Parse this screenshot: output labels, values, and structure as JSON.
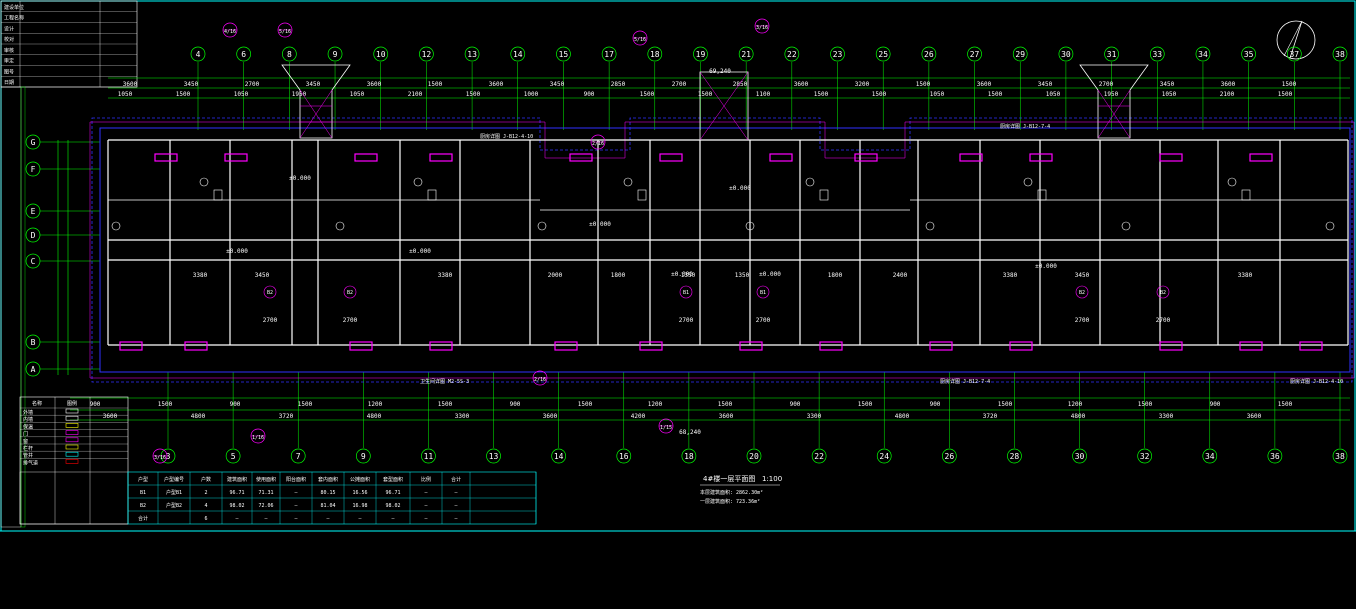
{
  "drawing": {
    "title": "4#楼一层平面图",
    "scale": "1:100",
    "area_line1": "本层建筑面积: 2862.30m²",
    "area_line2": "一层建筑面积: 723.36m²",
    "total_dim_top": "69,240",
    "total_dim_bottom": "68,240"
  },
  "axes": {
    "top_numbers": [
      "4",
      "6",
      "8",
      "9",
      "10",
      "12",
      "13",
      "14",
      "15",
      "17",
      "18",
      "19",
      "21",
      "22",
      "23",
      "25",
      "26",
      "27",
      "29",
      "30",
      "31",
      "33",
      "34",
      "35",
      "37",
      "38"
    ],
    "bottom_numbers": [
      "3",
      "5",
      "7",
      "9",
      "11",
      "13",
      "14",
      "16",
      "18",
      "20",
      "22",
      "24",
      "26",
      "28",
      "30",
      "32",
      "34",
      "36",
      "38"
    ],
    "left_letters": [
      "G",
      "F",
      "E",
      "D",
      "C",
      "B",
      "A"
    ]
  },
  "dimensions": {
    "top_row1": [
      "3600",
      "3450",
      "2700",
      "3450",
      "3600",
      "1500",
      "3600",
      "3450",
      "2850",
      "2700",
      "2850",
      "3600",
      "3200",
      "1500",
      "3600",
      "3450",
      "2700",
      "3450",
      "3600",
      "1500"
    ],
    "top_row2": [
      "1050",
      "1500",
      "1050",
      "1950",
      "1050",
      "2100",
      "1500",
      "1000",
      "900",
      "1500",
      "1500",
      "1100",
      "1500",
      "1500",
      "1050",
      "1500",
      "1050",
      "1950",
      "1050",
      "2100",
      "1500"
    ],
    "bottom_row1": [
      "900",
      "1500",
      "900",
      "1500",
      "1200",
      "1500",
      "900",
      "1500",
      "1200",
      "1500",
      "900",
      "1500",
      "900",
      "1500",
      "1200",
      "1500",
      "900",
      "1500"
    ],
    "bottom_row2": [
      "3600",
      "4800",
      "3720",
      "4800",
      "3300",
      "3600",
      "4200",
      "3600",
      "3300",
      "4800",
      "3720",
      "4800",
      "3300",
      "3600"
    ]
  },
  "rooms": {
    "unit_labels": [
      "B2",
      "B2",
      "B1",
      "B1",
      "B2",
      "B2"
    ],
    "elevations": [
      "±0.000",
      "±0.000",
      "±0.000",
      "±0.000",
      "±0.000",
      "±0.000",
      "±0.000",
      "±0.000"
    ],
    "room_widths": [
      "3380",
      "3450",
      "3380",
      "2000",
      "1800",
      "1350",
      "1350",
      "1800",
      "2400",
      "3380",
      "3450",
      "3380"
    ],
    "room_widths2": [
      "2700",
      "2700",
      "2700",
      "2700",
      "2700",
      "2700"
    ]
  },
  "callouts": {
    "notes": [
      "厨房详图 J-B12-7-4",
      "厨房详图 J-B12-4-10",
      "厨房详图 J-B12-7-4",
      "厨房详图 J-B12-4-10",
      "卫生间详图 M2-5S-3"
    ],
    "bubbles": [
      "4/16",
      "5/16",
      "3/16",
      "2/16",
      "1/16",
      "3/16",
      "2/16",
      "1/15",
      "5/16"
    ]
  },
  "legend": {
    "header": [
      "名称",
      "图例"
    ],
    "rows": [
      "外墙",
      "内墙",
      "保温",
      "门",
      "窗",
      "栏杆",
      "管井",
      "排气道"
    ]
  },
  "schedule": {
    "headers": [
      "户型",
      "户型编号",
      "户数",
      "建筑面积",
      "使用面积",
      "阳台面积",
      "套内面积",
      "公摊面积",
      "套型面积",
      "比例",
      "合计"
    ],
    "rows": [
      [
        "B1",
        "户型B1",
        "2",
        "96.71",
        "71.31",
        "—",
        "80.15",
        "16.56",
        "96.71",
        "—",
        "—"
      ],
      [
        "B2",
        "户型B2",
        "4",
        "98.02",
        "72.06",
        "—",
        "81.04",
        "16.98",
        "98.02",
        "—",
        "—"
      ],
      [
        "合计",
        "",
        "6",
        "—",
        "—",
        "—",
        "—",
        "—",
        "—",
        "—",
        "—"
      ]
    ]
  },
  "title_block": {
    "rows": [
      "建设单位",
      "工程名称",
      "设计",
      "校对",
      "审核",
      "审定",
      "图号",
      "日期"
    ]
  },
  "colors": {
    "background": "#000000",
    "axis_green": "#00ff00",
    "wall_white": "#ffffff",
    "dim_magenta": "#ff00ff",
    "outline_blue": "#3030ff",
    "text_yellow": "#ffff00",
    "cyan": "#00ffff",
    "red": "#ff0000"
  }
}
